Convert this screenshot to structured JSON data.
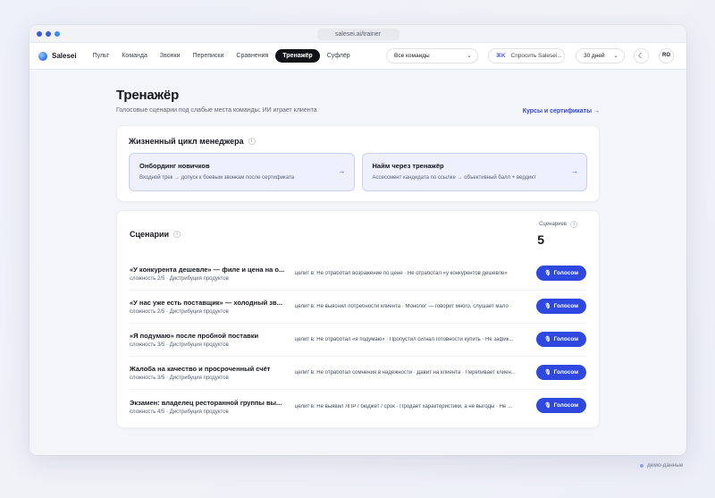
{
  "browser": {
    "url": "salesei.ai/trainer",
    "dot_colors": [
      "#3b5bdb",
      "#3b5bdb",
      "#3b8cf0"
    ]
  },
  "nav": {
    "brand": "Salesei",
    "items": [
      {
        "label": "Пульт",
        "active": false
      },
      {
        "label": "Команда",
        "active": false
      },
      {
        "label": "Звонки",
        "active": false
      },
      {
        "label": "Переписки",
        "active": false
      },
      {
        "label": "Сравнения",
        "active": false
      },
      {
        "label": "Тренажёр",
        "active": true
      },
      {
        "label": "Суфлёр",
        "active": false
      }
    ],
    "team_select": "Все команды",
    "ask_key": "⌘K",
    "ask_label": "Спросить Salesei...",
    "period": "30 дней",
    "avatar": "RO"
  },
  "page": {
    "title": "Тренажёр",
    "subtitle": "Голосовые сценарии под слабые места команды: ИИ играет клиента",
    "courses_link": "Курсы и сертификаты →"
  },
  "lifecycle": {
    "title": "Жизненный цикл менеджера",
    "info": "i",
    "tracks": [
      {
        "title": "Онбординг новичков",
        "desc": "Входной трек → допуск к боевым звонкам после сертификата",
        "arrow": "→"
      },
      {
        "title": "Найм через тренажёр",
        "desc": "Ассессмент кандидата по ссылке → объективный балл + вердикт",
        "arrow": "→"
      }
    ]
  },
  "scenarios": {
    "title": "Сценарии",
    "info": "i",
    "count_label": "Сценариев",
    "count": "5",
    "button_label": "Голосом",
    "rows": [
      {
        "title": "«У конкурента дешевле» — филе и цена на о...",
        "meta": "сложность 2/5 · Дистрибуция продуктов",
        "target": "целит в: Не отработал возражение по цене · Не отработал «у конкурентов дешевле»"
      },
      {
        "title": "«У нас уже есть поставщик» — холодный зв...",
        "meta": "сложность 2/5 · Дистрибуция продуктов",
        "target": "целит в: Не выяснил потребности клиента · Монолог — говорит много, слушает мало ·"
      },
      {
        "title": "«Я подумаю» после пробной поставки",
        "meta": "сложность 3/5 · Дистрибуция продуктов",
        "target": "целит в: Не отработал «я подумаю» · Пропустил сигнал готовности купить · Не зафик..."
      },
      {
        "title": "Жалоба на качество и просроченный счёт",
        "meta": "сложность 3/5 · Дистрибуция продуктов",
        "target": "целит в: Не отработал сомнения в надёжности · Давит на клиента · Перебивает клиен..."
      },
      {
        "title": "Экзамен: владелец ресторанной группы вы...",
        "meta": "сложность 4/5 · Дистрибуция продуктов",
        "target": "целит в: Не выявил ЛПР / бюджет / срок · Продаёт характеристики, а не выгоды · Не ..."
      }
    ]
  },
  "footer": {
    "demo_label": "демо-данные"
  }
}
